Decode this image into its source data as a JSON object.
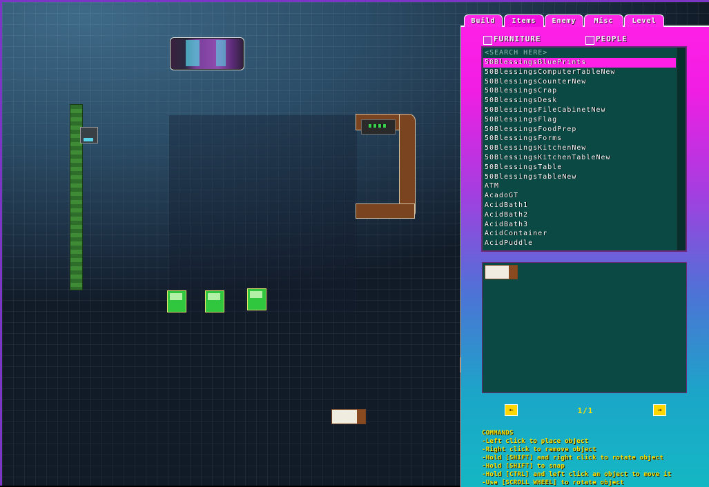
{
  "tabs": [
    "Build",
    "Items",
    "Enemy",
    "Misc",
    "Level"
  ],
  "active_tab": "Items",
  "filters": {
    "furniture": "FURNITURE",
    "people": "PEOPLE"
  },
  "search": {
    "placeholder": "<SEARCH HERE>"
  },
  "items": [
    "50BlessingsBluePrints",
    "50BlessingsComputerTableNew",
    "50BlessingsCounterNew",
    "50BlessingsCrap",
    "50BlessingsDesk",
    "50BlessingsFileCabinetNew",
    "50BlessingsFlag",
    "50BlessingsFoodPrep",
    "50BlessingsForms",
    "50BlessingsKitchenNew",
    "50BlessingsKitchenTableNew",
    "50BlessingsTable",
    "50BlessingsTableNew",
    "ATM",
    "AcadoGT",
    "AcidBath1",
    "AcidBath2",
    "AcidBath3",
    "AcidContainer",
    "AcidPuddle"
  ],
  "selected_index": 0,
  "pagination": {
    "label": "1/1",
    "prev_icon": "arrow-left-icon",
    "next_icon": "arrow-right-icon"
  },
  "commands": {
    "title": "COMMANDS",
    "lines": [
      "-Left click to place object",
      "-Right click to remove object",
      "-Hold [SHIFT] and right click to rotate object",
      "-Hold [SHIFT] to snap",
      "-Hold [CTRL] and left click an object to move it",
      "-Use [SCROLL WHEEL] to rotate object"
    ]
  },
  "colors": {
    "panel_top": "#ff1fe6",
    "panel_bottom": "#14b7c4",
    "list_bg": "#0b4a44",
    "selection": "#ff1fe6",
    "command_text": "#ffe300"
  }
}
